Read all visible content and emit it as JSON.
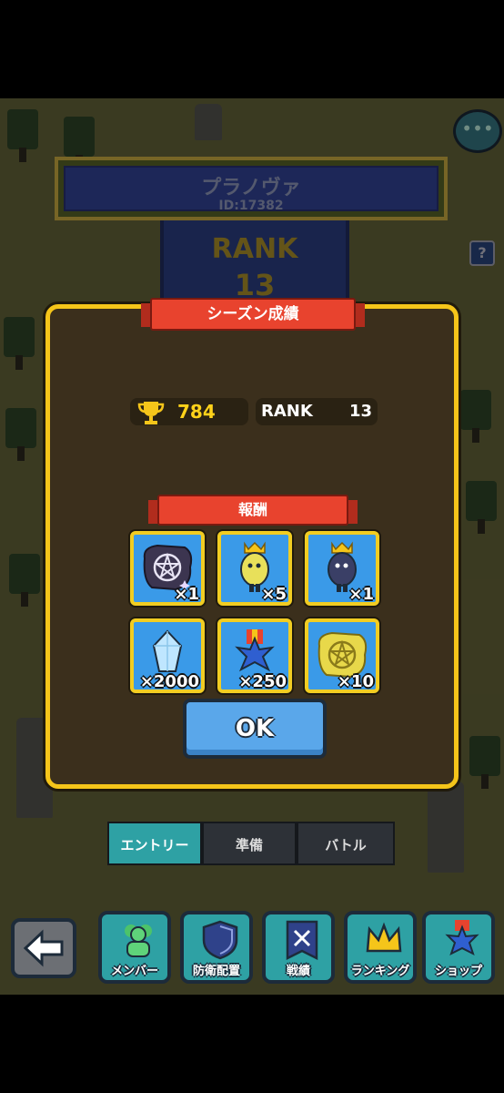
{
  "header": {
    "player_name": "プラノヴァ",
    "player_id": "ID:17382",
    "rank_label": "RANK",
    "rank_number": "13"
  },
  "modal": {
    "title": "シーズン成績",
    "trophy_value": "784",
    "rank_label": "RANK",
    "rank_value": "13",
    "rewards_title": "報酬",
    "rewards": [
      {
        "icon": "dark-pentagram-emblem-icon",
        "qty": "×1"
      },
      {
        "icon": "yellow-crowned-egg-icon",
        "qty": "×5"
      },
      {
        "icon": "dark-crowned-egg-icon",
        "qty": "×1"
      },
      {
        "icon": "blue-crystal-icon",
        "qty": "×2000"
      },
      {
        "icon": "blue-star-medal-icon",
        "qty": "×250"
      },
      {
        "icon": "gold-pentagram-emblem-icon",
        "qty": "×10"
      }
    ],
    "ok_label": "OK"
  },
  "steps": [
    "エントリー",
    "準備",
    "バトル"
  ],
  "nav": {
    "members": "メンバー",
    "defense": "防衛配置",
    "record": "戦績",
    "ranking": "ランキング",
    "shop": "ショップ"
  },
  "colors": {
    "modal_border": "#f5c51a",
    "ribbon": "#e8432e",
    "reward_bg": "#3a9ae8",
    "ok_button": "#5aa7ea",
    "teal_button": "#2ea1a4"
  }
}
